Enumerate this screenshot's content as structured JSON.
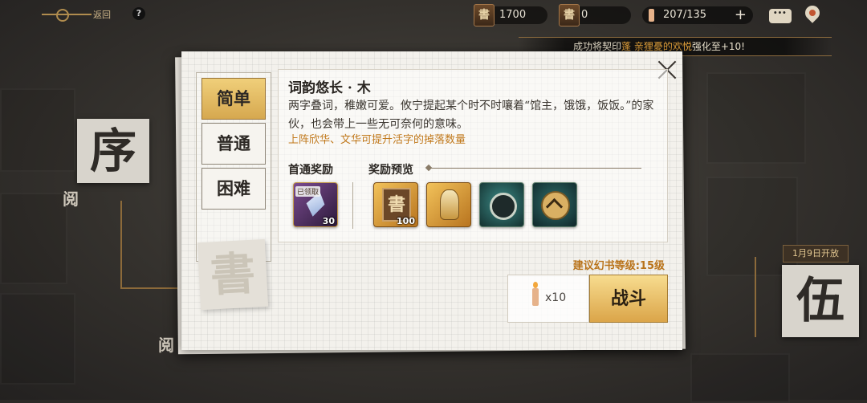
{
  "topbar": {
    "back_label": "返回",
    "help_symbol": "?",
    "resources": [
      {
        "icon": "書",
        "value": "1700"
      },
      {
        "icon": "書",
        "value": "0"
      },
      {
        "icon": "candle-icon",
        "value": "207/135"
      }
    ],
    "plus_symbol": "+"
  },
  "ticker": {
    "prefix": "成功将契印",
    "highlight": "蓬 亲狸憂的欢悦",
    "suffix": "强化至+10!"
  },
  "background": {
    "chapter_title": "序",
    "chapter_title_right": "伍",
    "reading_marker": "阅",
    "unlock_date": "1月9日开放"
  },
  "stage": {
    "title": "词韵悠长 · 木",
    "description": "两字叠词，稚嫩可爱。攸宁提起某个时不时嚷着“馆主，饿饿，饭饭。”的家伙，也会带上一些无可奈何的意味。",
    "hint": "上阵欣华、文华可提升活字的掉落数量",
    "difficulties": [
      "简单",
      "普通",
      "困难"
    ],
    "active_difficulty": 0,
    "first_reward_label": "首通奖励",
    "preview_label": "奖励预览",
    "first_reward": {
      "tag": "已领取",
      "qty": "30",
      "icon": "crystal-icon"
    },
    "rewards": [
      {
        "icon": "book-icon",
        "qty": "100"
      },
      {
        "icon": "perfume-bottle-icon",
        "qty": ""
      },
      {
        "icon": "mechanism-icon",
        "qty": ""
      },
      {
        "icon": "chevron-emblem-icon",
        "qty": ""
      }
    ],
    "recommended_level": "建议幻书等级:15级",
    "cost_qty": "x10",
    "fight_label": "战斗",
    "stamp_char": "書"
  },
  "colors": {
    "accent_gold": "#dba549",
    "hint_orange": "#c1791c",
    "panel_bg": "#f3f1ec"
  }
}
